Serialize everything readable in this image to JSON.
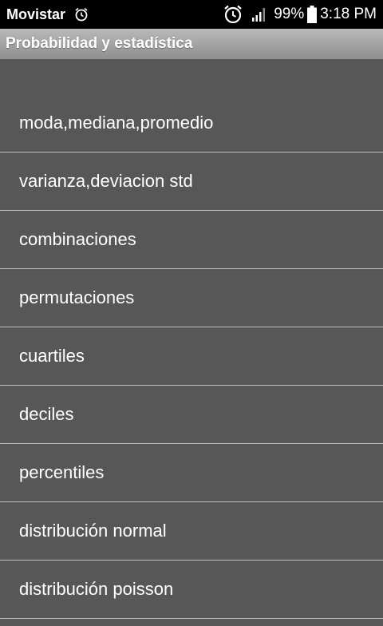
{
  "status_bar": {
    "carrier": "Movistar",
    "battery_percent": "99%",
    "time": "3:18 PM",
    "icons": [
      "alarm-icon",
      "alarm-clock-icon",
      "signal-icon",
      "battery-icon"
    ]
  },
  "app_bar": {
    "title": "Probabilidad y estadística"
  },
  "menu": {
    "items": [
      {
        "label": "moda,mediana,promedio"
      },
      {
        "label": "varianza,deviacion std"
      },
      {
        "label": "combinaciones"
      },
      {
        "label": "permutaciones"
      },
      {
        "label": "cuartiles"
      },
      {
        "label": "deciles"
      },
      {
        "label": "percentiles"
      },
      {
        "label": "distribución normal"
      },
      {
        "label": "distribución poisson"
      }
    ]
  },
  "colors": {
    "background": "#575757",
    "status_bar": "#000000",
    "divider": "#bdbdbd",
    "text": "#ffffff"
  }
}
